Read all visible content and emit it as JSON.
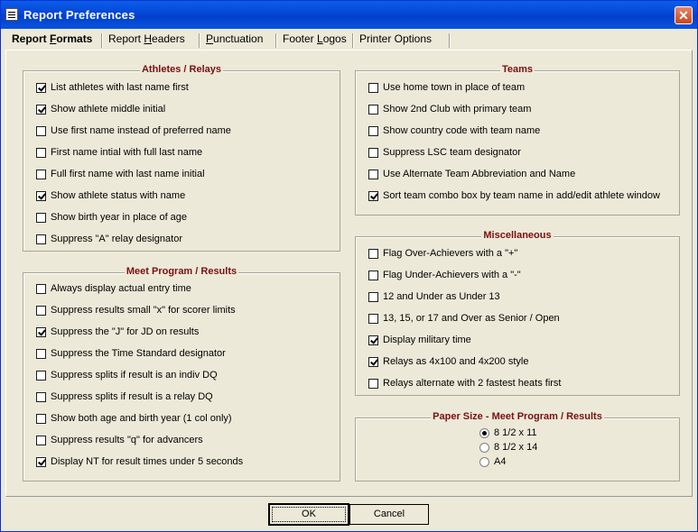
{
  "window": {
    "title": "Report Preferences",
    "close_glyph": "✕"
  },
  "tabs": [
    {
      "pre": "Report ",
      "u": "F",
      "post": "ormats"
    },
    {
      "pre": "Report ",
      "u": "H",
      "post": "eaders"
    },
    {
      "pre": "",
      "u": "P",
      "post": "unctuation"
    },
    {
      "pre": "Footer ",
      "u": "L",
      "post": "ogos"
    },
    {
      "pre": "Printer Options",
      "u": "",
      "post": ""
    }
  ],
  "athletes_relays": {
    "title": "Athletes / Relays",
    "items": [
      {
        "label": "List athletes with last name first",
        "checked": true
      },
      {
        "label": "Show athlete middle initial",
        "checked": true
      },
      {
        "label": "Use first name instead of preferred name",
        "checked": false
      },
      {
        "label": "First name intial with full last name",
        "checked": false
      },
      {
        "label": "Full first name with last name initial",
        "checked": false
      },
      {
        "label": "Show athlete status with name",
        "checked": true
      },
      {
        "label": "Show birth year in place of age",
        "checked": false
      },
      {
        "label": "Suppress \"A\" relay designator",
        "checked": false
      }
    ]
  },
  "meet_program": {
    "title": "Meet Program / Results",
    "items": [
      {
        "label": "Always display actual entry time",
        "checked": false
      },
      {
        "label": "Suppress results small \"x\" for scorer limits",
        "checked": false
      },
      {
        "label": "Suppress the \"J\" for JD on results",
        "checked": true
      },
      {
        "label": "Suppress the Time Standard designator",
        "checked": false
      },
      {
        "label": "Suppress splits if result is an indiv DQ",
        "checked": false
      },
      {
        "label": "Suppress splits if result is a relay DQ",
        "checked": false
      },
      {
        "label": "Show both age and birth year (1 col only)",
        "checked": false
      },
      {
        "label": "Suppress results \"q\" for advancers",
        "checked": false
      },
      {
        "label": "Display NT for result times under 5 seconds",
        "checked": true
      }
    ]
  },
  "teams": {
    "title": "Teams",
    "items": [
      {
        "label": "Use home town in place of team",
        "checked": false
      },
      {
        "label": "Show 2nd Club with primary team",
        "checked": false
      },
      {
        "label": "Show country code with team name",
        "checked": false
      },
      {
        "label": "Suppress LSC team designator",
        "checked": false
      },
      {
        "label": "Use Alternate Team Abbreviation and Name",
        "checked": false
      },
      {
        "label": "Sort team combo box by team name in add/edit athlete window",
        "checked": true
      }
    ]
  },
  "miscellaneous": {
    "title": "Miscellaneous",
    "items": [
      {
        "label": "Flag Over-Achievers with a \"+\"",
        "checked": false
      },
      {
        "label": "Flag Under-Achievers with a \"-\"",
        "checked": false
      },
      {
        "label": "12 and Under as Under 13",
        "checked": false
      },
      {
        "label": "13, 15, or 17 and Over as Senior / Open",
        "checked": false
      },
      {
        "label": "Display military time",
        "checked": true
      },
      {
        "label": "Relays as 4x100 and 4x200 style",
        "checked": true
      },
      {
        "label": "Relays alternate with 2 fastest heats first",
        "checked": false
      }
    ]
  },
  "paper_size": {
    "title": "Paper Size - Meet Program / Results",
    "options": [
      {
        "label": "8 1/2 x 11",
        "selected": true
      },
      {
        "label": "8 1/2 x 14",
        "selected": false
      },
      {
        "label": "A4",
        "selected": false
      }
    ]
  },
  "buttons": {
    "ok": "OK",
    "cancel": "Cancel"
  }
}
